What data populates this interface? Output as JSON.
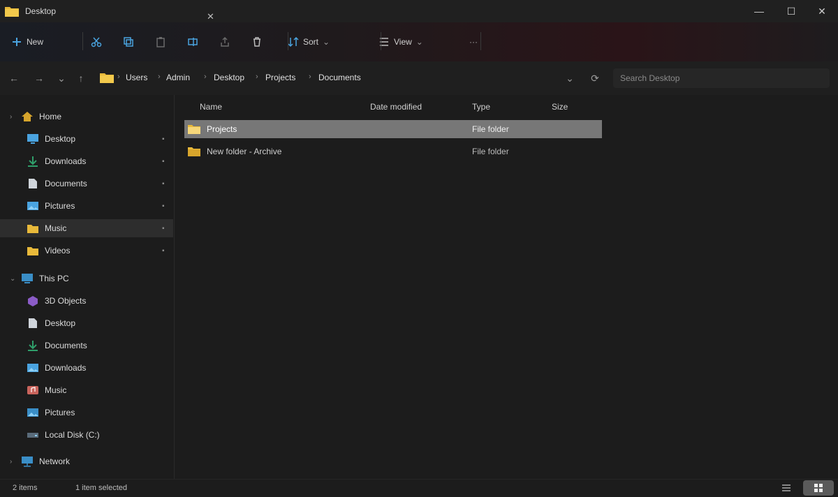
{
  "window": {
    "title": "Desktop",
    "tab_close_glyph": "✕",
    "controls": {
      "minimize": "—",
      "maximize": "☐",
      "close": "✕"
    }
  },
  "commandbar": {
    "new_label": "New",
    "new_icon": "plus-icon",
    "cut_icon": "scissors-icon",
    "copy_icon": "copy-icon",
    "paste_icon": "clipboard-icon",
    "rename_icon": "rename-icon",
    "share_icon": "share-icon",
    "delete_icon": "trash-icon",
    "sort_label": "Sort",
    "view_label": "View",
    "more_glyph": "···"
  },
  "address": {
    "back": "←",
    "forward": "→",
    "up": "↑",
    "down_arrow": "⌄",
    "crumb_sep": "›",
    "breadcrumbs": [
      "Users",
      "Admin",
      "Desktop",
      "Projects",
      "Documents"
    ],
    "refresh_glyph": "⟳",
    "search_placeholder": "Search Desktop"
  },
  "sidebar": {
    "home_label": "Home",
    "quick_access": [
      "Desktop",
      "Downloads",
      "Documents",
      "Pictures",
      "Music",
      "Videos"
    ],
    "this_pc_label": "This PC",
    "this_pc_items": [
      "3D Objects",
      "Desktop",
      "Documents",
      "Downloads",
      "Music",
      "Pictures",
      "Local Disk (C:)"
    ],
    "network_label": "Network",
    "pin_glyph": "📌"
  },
  "content": {
    "columns": [
      "Name",
      "Date modified",
      "Type",
      "Size"
    ],
    "rows": [
      {
        "name": "Projects",
        "date": "",
        "type": "File folder",
        "size": ""
      },
      {
        "name": "New folder - Archive",
        "date": "",
        "type": "File folder",
        "size": ""
      }
    ]
  },
  "status": {
    "item_count": "2 items",
    "selection": "1 item selected"
  },
  "colors": {
    "folder": "#e8b93a",
    "accent": "#4aa3df",
    "background": "#1c1c1c"
  }
}
